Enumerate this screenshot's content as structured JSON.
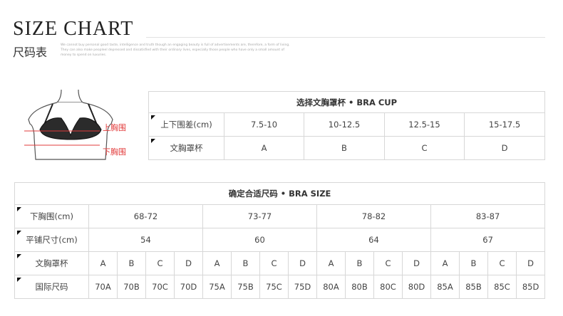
{
  "header": {
    "title": "SIZE CHART",
    "subtitle": "尺码表",
    "small_text": "We cannot buy personal good taste, intelligence and truth though an engaging beauty is full of advertisements are, therefore, a form of living. They can also make peopleel depressed and dissatisfied with their ordinary lives, especially those people who have only a small amount of money to spend on luxuries."
  },
  "figure": {
    "upper_label": "上胸围",
    "lower_label": "下胸围",
    "line_color": "#e23b3b"
  },
  "cup_table": {
    "title": "选择文胸罩杯 • BRA CUP",
    "rows": [
      {
        "label": "上下围差(cm)",
        "cells": [
          "7.5-10",
          "10-12.5",
          "12.5-15",
          "15-17.5"
        ]
      },
      {
        "label": "文胸罩杯",
        "cells": [
          "A",
          "B",
          "C",
          "D"
        ]
      }
    ]
  },
  "size_table": {
    "title": "确定合适尺码 • BRA SIZE",
    "underbust_label": "下胸围(cm)",
    "underbust": [
      "68-72",
      "73-77",
      "78-82",
      "83-87"
    ],
    "flat_label": "平铺尺寸(cm)",
    "flat": [
      "54",
      "60",
      "64",
      "67"
    ],
    "cup_label": "文胸罩杯",
    "cups": [
      "A",
      "B",
      "C",
      "D",
      "A",
      "B",
      "C",
      "D",
      "A",
      "B",
      "C",
      "D",
      "A",
      "B",
      "C",
      "D"
    ],
    "intl_label": "国际尺码",
    "intl": [
      "70A",
      "70B",
      "70C",
      "70D",
      "75A",
      "75B",
      "75C",
      "75D",
      "80A",
      "80B",
      "80C",
      "80D",
      "85A",
      "85B",
      "85C",
      "85D"
    ]
  }
}
